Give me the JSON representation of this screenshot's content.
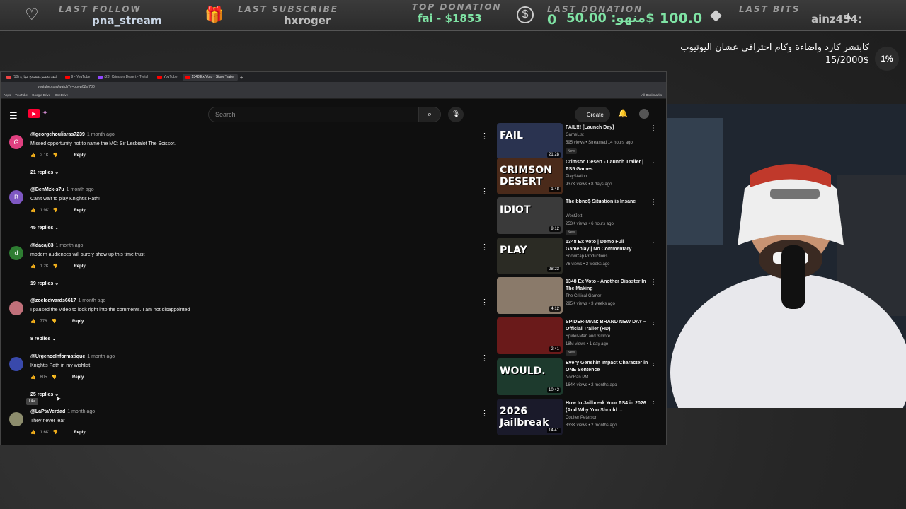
{
  "overlay": {
    "last_follow": {
      "label": "LAST FOLLOW",
      "value": "pna_stream"
    },
    "last_subscribe": {
      "label": "LAST SUBSCRIBE",
      "value": "hxroger"
    },
    "top_donation": {
      "label": "TOP DONATION",
      "value": "fai - $1853"
    },
    "last_donation": {
      "label": "LAST DONATION",
      "amount": "0",
      "value": "منهو: 50.00$",
      "extra": "100.0"
    },
    "last_bits": {
      "label": "LAST BITS",
      "value": "ainz454:"
    }
  },
  "campaign": {
    "title": "كابتشر كارد واضاءة وكام احترافي عشان اليوتيوب",
    "count": "15/2000$",
    "percent": "1%"
  },
  "browser": {
    "tabs": [
      "(10) كيف تحسن وتصحح مهارة",
      "9 - YouTube",
      "(28) Crimson Desert - Twitch",
      "YouTube",
      "1348 Ex Voto - Story Trailer"
    ],
    "url": "youtube.com/watch?v=ogvw0Zxl780",
    "bookmarks": [
      "Apps",
      "YouTube",
      "Google Drive",
      "OneDrive",
      "All Bookmarks"
    ]
  },
  "youtube": {
    "search_placeholder": "Search",
    "create_label": "Create",
    "comments": [
      {
        "user": "@georgehouliaras7239",
        "age": "1 month ago",
        "text": "Missed opportunity not to name the MC: Sir Lesbialot The Scissor.",
        "likes": "2.1K",
        "reply": "Reply",
        "replies": "21 replies",
        "avatar": "G",
        "color": "#e04080"
      },
      {
        "user": "@BenMzk-s7u",
        "age": "1 month ago",
        "text": "Can't wait to play Knight's Path!",
        "likes": "1.9K",
        "reply": "Reply",
        "replies": "45 replies",
        "avatar": "B",
        "color": "#7e57c2"
      },
      {
        "user": "@dacaj83",
        "age": "1 month ago",
        "text": "modern audiences will surely show up this time trust",
        "likes": "1.2K",
        "reply": "Reply",
        "replies": "19 replies",
        "avatar": "d",
        "color": "#2e7d32"
      },
      {
        "user": "@zoeledwards6617",
        "age": "1 month ago",
        "text": "I paused the video to look right into the comments. I am not disappointed",
        "likes": "778",
        "reply": "Reply",
        "replies": "8 replies",
        "avatar": "",
        "color": "#c0707a"
      },
      {
        "user": "@UrgenceInformatique",
        "age": "1 month ago",
        "text": "Knight's Path in my wishlist",
        "likes": "805",
        "reply": "Reply",
        "replies": "25 replies",
        "avatar": "",
        "color": "#3949ab"
      },
      {
        "user": "@LaPtaVerdad",
        "age": "1 month ago",
        "text": "They never lear",
        "likes": "1.6K",
        "reply": "Reply",
        "replies": "",
        "avatar": "",
        "color": "#8d8d6d"
      }
    ],
    "tooltip": "Like",
    "videos": [
      {
        "title": "FAIL!!! [Launch Day]",
        "channel": "GameList+",
        "meta": "595 views • Streamed 14 hours ago",
        "badge": "New",
        "duration": "21:28",
        "thumb_text": "FAIL",
        "thumb_color": "#2a3350"
      },
      {
        "title": "Crimson Desert - Launch Trailer | PS5 Games",
        "channel": "PlayStation",
        "meta": "937K views • 8 days ago",
        "badge": "",
        "duration": "1:48",
        "thumb_text": "CRIMSON DESERT",
        "thumb_color": "#4a2a1a"
      },
      {
        "title": "The bbno$ Situation is Insane",
        "channel": "WestJett",
        "meta": "253K views • 6 hours ago",
        "badge": "New",
        "duration": "9:12",
        "thumb_text": "IDIOT",
        "thumb_color": "#3a3a3a"
      },
      {
        "title": "1348 Ex Voto | Demo Full Gameplay | No Commentary",
        "channel": "SnowCap Productions",
        "meta": "76 views • 2 weeks ago",
        "badge": "",
        "duration": "28:23",
        "thumb_text": "PLAY",
        "thumb_color": "#2b2b24"
      },
      {
        "title": "1348 Ex Voto - Another Disaster In The Making",
        "channel": "The Critical Gamer",
        "meta": "295K views • 3 weeks ago",
        "badge": "",
        "duration": "4:12",
        "thumb_text": "",
        "thumb_color": "#8a7a6a"
      },
      {
        "title": "SPIDER-MAN: BRAND NEW DAY – Official Trailer (HD)",
        "channel": "Spider-Man and 3 more",
        "meta": "18M views • 1 day ago",
        "badge": "New",
        "duration": "2:41",
        "thumb_text": "",
        "thumb_color": "#6a1a1a"
      },
      {
        "title": "Every Genshin Impact Character in ONE Sentence",
        "channel": "NocRan PM",
        "meta": "164K views • 2 months ago",
        "badge": "",
        "duration": "10:42",
        "thumb_text": "WOULD.",
        "thumb_color": "#1d3a2d"
      },
      {
        "title": "How to Jailbreak Your PS4 in 2026 (And Why You Should ...",
        "channel": "Coulter Peterson",
        "meta": "833K views • 2 months ago",
        "badge": "",
        "duration": "14:41",
        "thumb_text": "2026 Jailbreak",
        "thumb_color": "#1a1a2a"
      }
    ]
  }
}
